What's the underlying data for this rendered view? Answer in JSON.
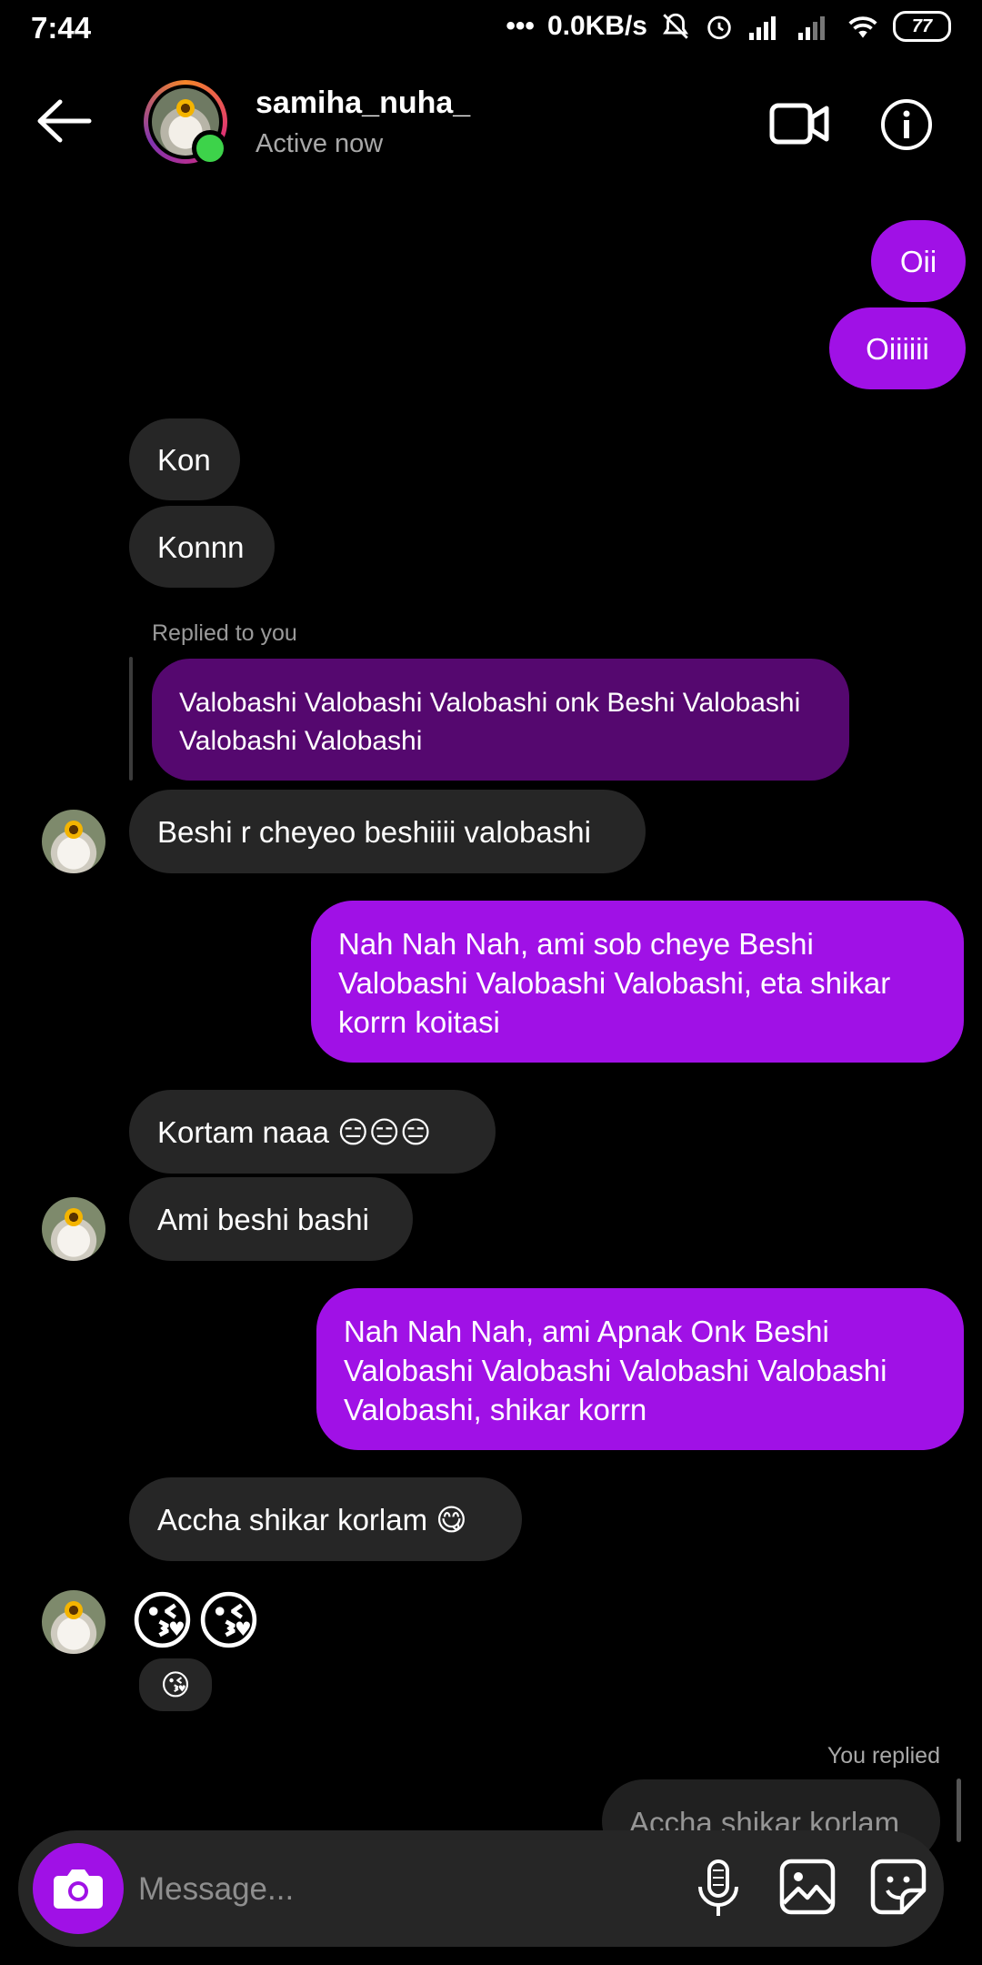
{
  "status_bar": {
    "time": "7:44",
    "network_speed": "0.0KB/s",
    "battery": "77"
  },
  "header": {
    "username": "samiha_nuha_",
    "status": "Active now"
  },
  "messages": {
    "m1": "Oii",
    "m2": "Oiiiiii",
    "m3": "Kon",
    "m4": "Konnn",
    "replied_label": "Replied to you",
    "quoted": "Valobashi Valobashi Valobashi onk Beshi Valobashi Valobashi Valobashi",
    "m5": "Beshi r cheyeo beshiiii valobashi",
    "m6": "Nah Nah Nah, ami sob cheye Beshi Valobashi Valobashi Valobashi, eta shikar korrn koitasi",
    "m7": "Kortam naaa 😑😑😑",
    "m8": "Ami beshi bashi",
    "m9": "Nah Nah Nah, ami Apnak Onk Beshi Valobashi Valobashi Valobashi Valobashi Valobashi, shikar korrn",
    "m10": "Accha shikar korlam 😋",
    "m11": "😘😘",
    "reaction": "😘",
    "you_replied_label": "You replied",
    "reply_preview": "Accha shikar korlam 😋"
  },
  "composer": {
    "placeholder": "Message..."
  }
}
